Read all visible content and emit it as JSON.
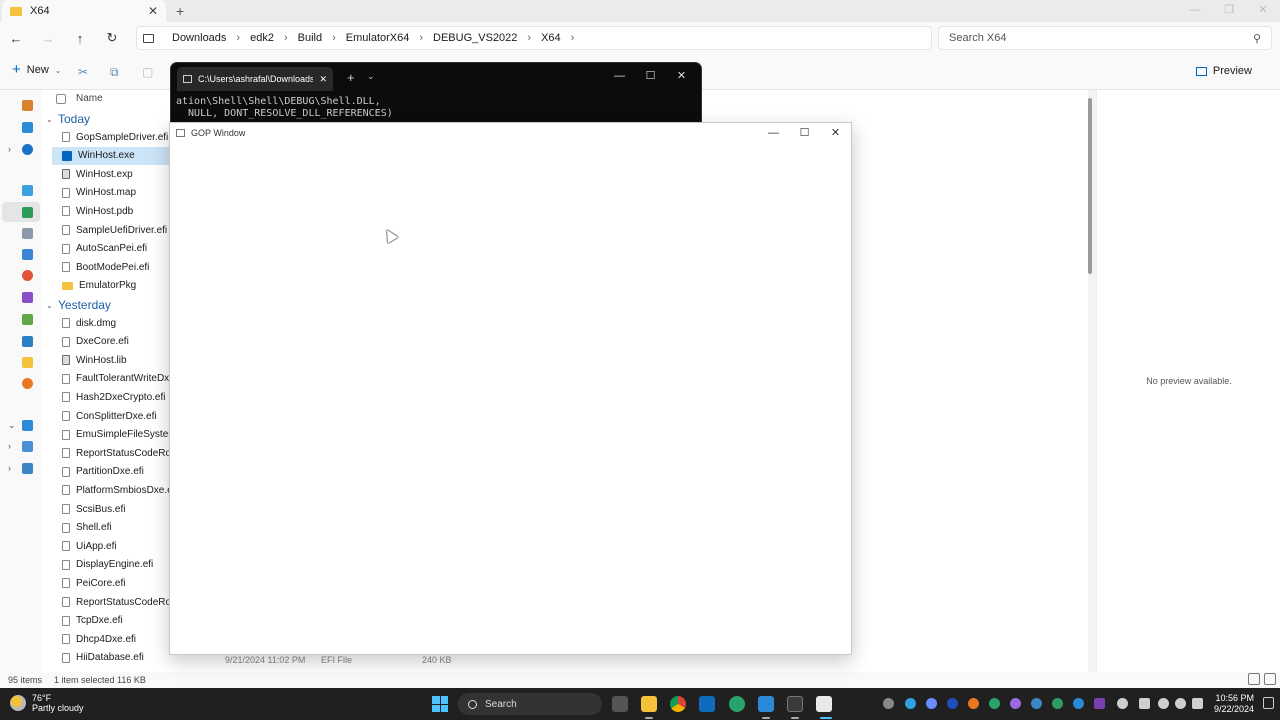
{
  "explorer": {
    "tab_title": "X64",
    "breadcrumbs": [
      "Downloads",
      "edk2",
      "Build",
      "EmulatorX64",
      "DEBUG_VS2022",
      "X64"
    ],
    "search_placeholder": "Search X64",
    "new_label": "New",
    "preview_label": "Preview",
    "column_name": "Name",
    "groups": {
      "today": "Today",
      "yesterday": "Yesterday"
    },
    "files_today": [
      {
        "name": "GopSampleDriver.efi",
        "kind": "file"
      },
      {
        "name": "WinHost.exe",
        "kind": "selected"
      },
      {
        "name": "WinHost.exp",
        "kind": "app"
      },
      {
        "name": "WinHost.map",
        "kind": "file"
      },
      {
        "name": "WinHost.pdb",
        "kind": "file"
      },
      {
        "name": "SampleUefiDriver.efi",
        "kind": "file"
      },
      {
        "name": "AutoScanPei.efi",
        "kind": "file"
      },
      {
        "name": "BootModePei.efi",
        "kind": "file"
      },
      {
        "name": "EmulatorPkg",
        "kind": "folder"
      }
    ],
    "files_yesterday": [
      {
        "name": "disk.dmg",
        "kind": "file"
      },
      {
        "name": "DxeCore.efi",
        "kind": "file"
      },
      {
        "name": "WinHost.lib",
        "kind": "app"
      },
      {
        "name": "FaultTolerantWriteDxe.efi",
        "kind": "file"
      },
      {
        "name": "Hash2DxeCrypto.efi",
        "kind": "file"
      },
      {
        "name": "ConSplitterDxe.efi",
        "kind": "file"
      },
      {
        "name": "EmuSimpleFileSystem.efi",
        "kind": "file"
      },
      {
        "name": "ReportStatusCodeRouterPei.efi",
        "kind": "file"
      },
      {
        "name": "PartitionDxe.efi",
        "kind": "file"
      },
      {
        "name": "PlatformSmbiosDxe.efi",
        "kind": "file"
      },
      {
        "name": "ScsiBus.efi",
        "kind": "file"
      },
      {
        "name": "Shell.efi",
        "kind": "file"
      },
      {
        "name": "UiApp.efi",
        "kind": "file"
      },
      {
        "name": "DisplayEngine.efi",
        "kind": "file"
      },
      {
        "name": "PeiCore.efi",
        "kind": "file"
      },
      {
        "name": "ReportStatusCodeRouterRuntimeDxe.efi",
        "kind": "file"
      },
      {
        "name": "TcpDxe.efi",
        "kind": "file"
      },
      {
        "name": "Dhcp4Dxe.efi",
        "kind": "file"
      },
      {
        "name": "HiiDatabase.efi",
        "kind": "file"
      }
    ],
    "last_row_meta": {
      "date": "9/21/2024 11:02 PM",
      "type": "EFI File",
      "size": "240 KB"
    },
    "preview_text": "No preview available.",
    "status": {
      "count": "95 items",
      "selection": "1 item selected  116 KB"
    }
  },
  "terminal": {
    "tab_title": "C:\\Users\\ashrafal\\Downloads\\",
    "output": "ation\\Shell\\Shell\\DEBUG\\Shell.DLL,\n  NULL, DONT_RESOLVE_DLL_REFERENCES)"
  },
  "gop_window": {
    "title": "GOP Window"
  },
  "taskbar": {
    "weather_temp": "76°F",
    "weather_desc": "Partly cloudy",
    "search_label": "Search",
    "time": "10:56 PM",
    "date": "9/22/2024"
  },
  "colors": {
    "accent": "#0067c0",
    "selection": "#cce4f7",
    "folder": "#f5c33b",
    "taskbar": "#202020",
    "terminal_bg": "#0c0c0c"
  }
}
